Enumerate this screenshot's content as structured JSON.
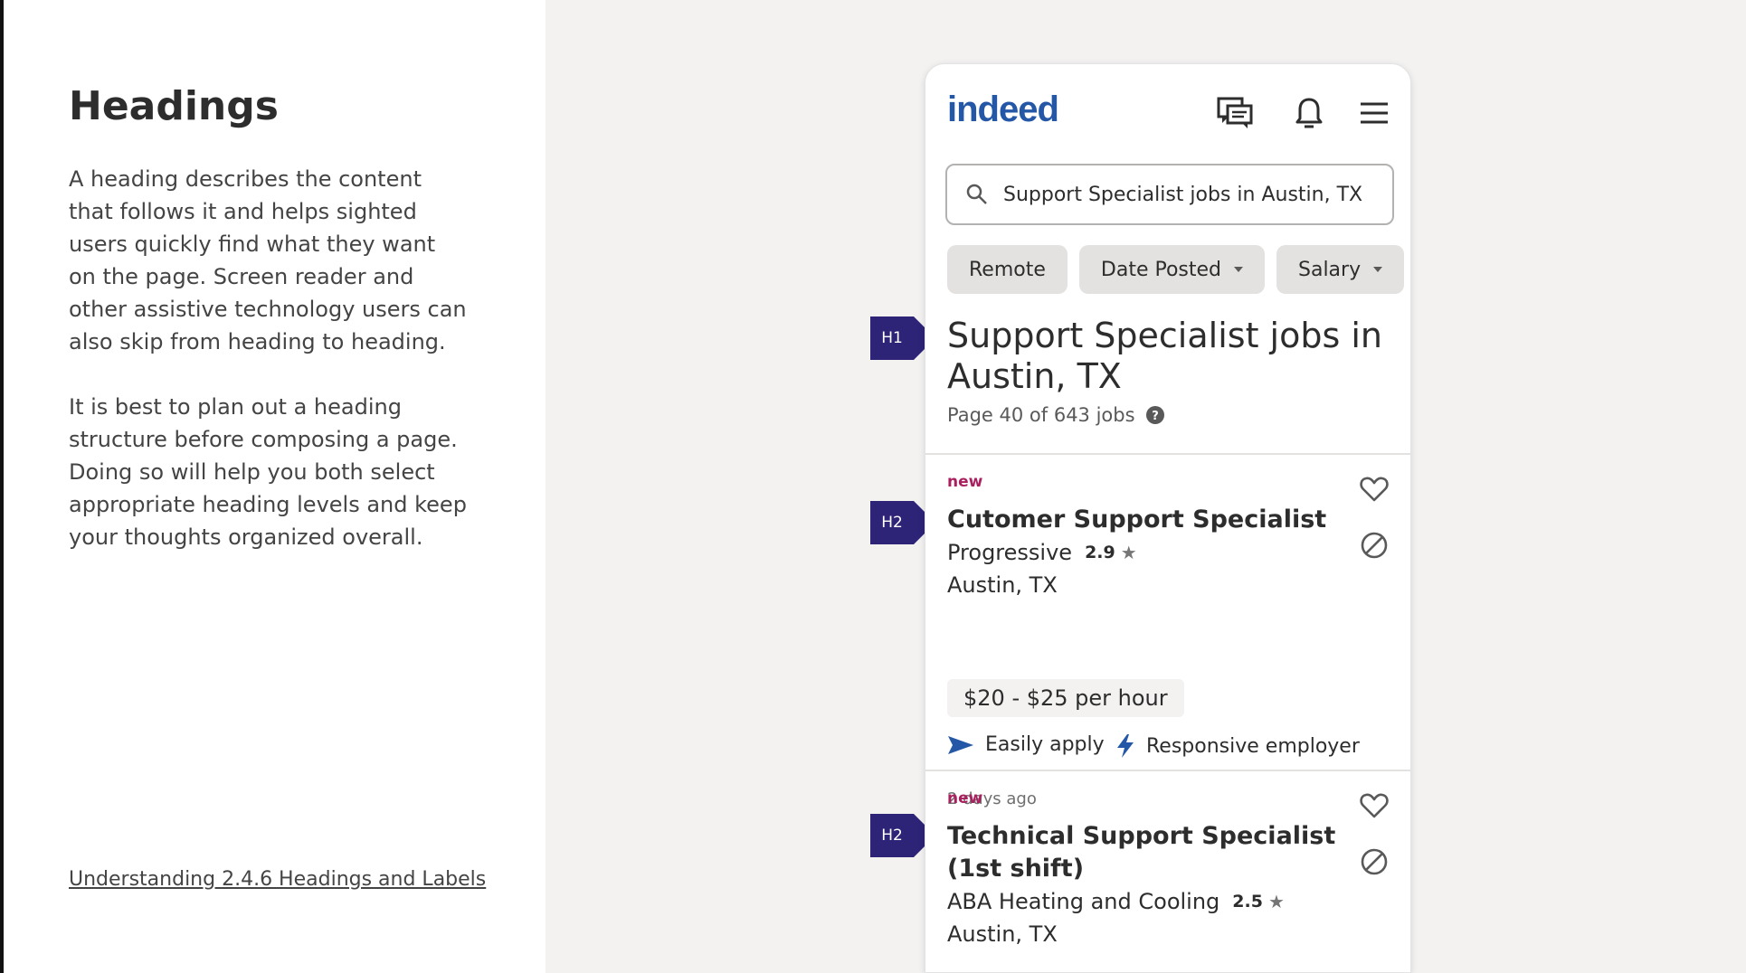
{
  "left": {
    "title": "Headings",
    "paragraph1": "A heading describes the content that follows it and helps sighted users quickly find what they want on the page. Screen reader and other assistive technology users can also skip from heading to heading.",
    "paragraph2": "It is best to plan out a heading structure before composing a page. Doing so will help you both select appropriate heading levels and keep your thoughts organized overall.",
    "link": "Understanding 2.4.6 Headings and Labels"
  },
  "header": {
    "logo": "indeed",
    "icons": [
      "messages-icon",
      "notifications-icon",
      "menu-icon"
    ]
  },
  "search": {
    "value": "Support Specialist jobs in Austin, TX",
    "icon": "search-icon"
  },
  "filters": [
    {
      "label": "Remote",
      "dropdown": false
    },
    {
      "label": "Date Posted",
      "dropdown": true
    },
    {
      "label": "Salary",
      "dropdown": true
    }
  ],
  "results": {
    "heading": "Support Specialist jobs in Austin, TX",
    "count": "Page 40 of 643 jobs"
  },
  "markers": {
    "h1": "H1",
    "h2": "H2"
  },
  "jobs": [
    {
      "tag": "new",
      "title": "Cutomer Support Specialist",
      "company": "Progressive",
      "rating": "2.9",
      "location": "Austin, TX",
      "salary": "$20 - $25 per hour",
      "feature1": "Easily apply",
      "feature2": "Responsive employer",
      "posted": "2 days ago"
    },
    {
      "tag": "new",
      "title": "Technical Support Specialist (1st shift)",
      "company": "ABA Heating and Cooling",
      "rating": "2.5",
      "location": "Austin, TX"
    }
  ],
  "colors": {
    "brand": "#2557a7",
    "new_tag": "#a9205f",
    "marker": "#2d2377"
  }
}
